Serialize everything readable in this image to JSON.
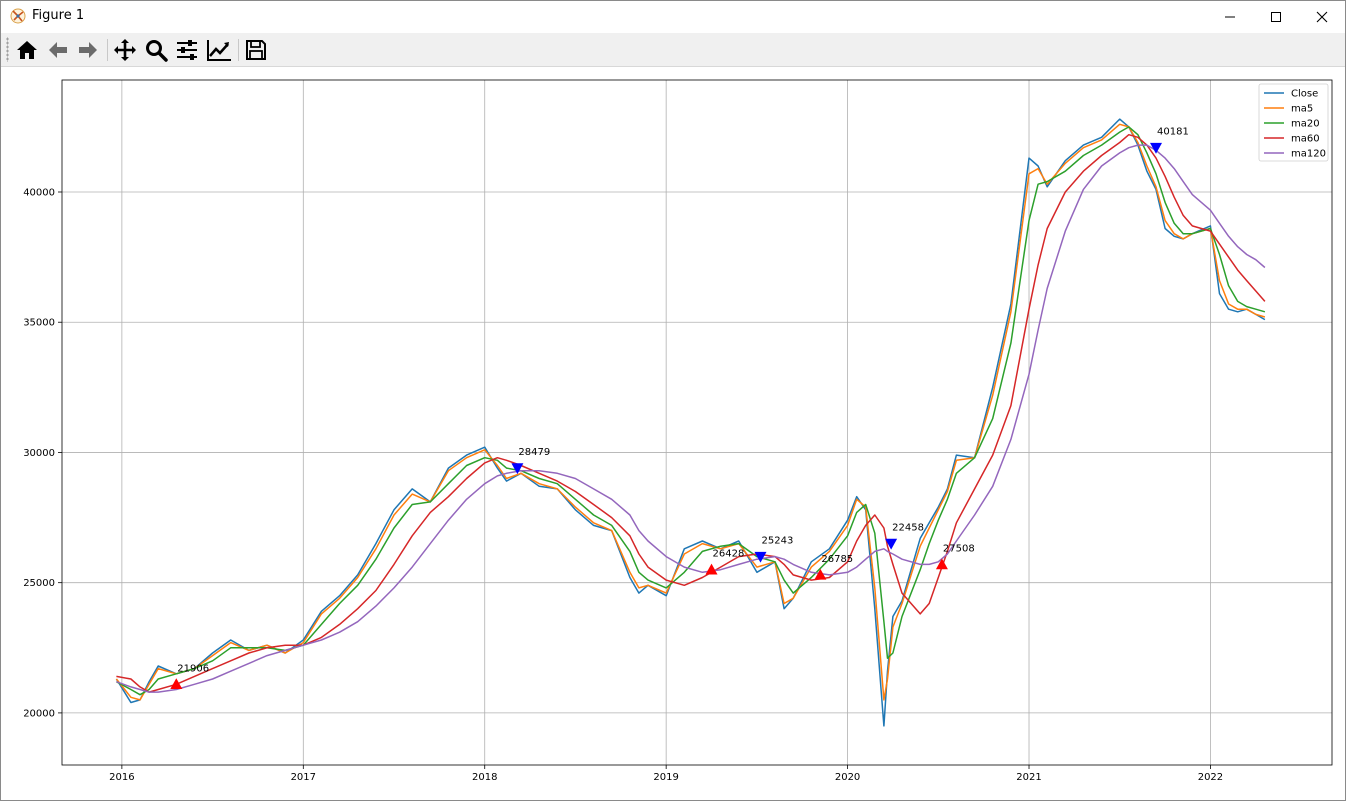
{
  "window": {
    "title": "Figure 1",
    "controls": {
      "minimize": "minimize",
      "maximize": "maximize",
      "close": "close"
    }
  },
  "toolbar": {
    "tools": [
      {
        "name": "home",
        "icon": "home-icon"
      },
      {
        "name": "back",
        "icon": "arrow-left-icon"
      },
      {
        "name": "forward",
        "icon": "arrow-right-icon"
      },
      {
        "name": "pan",
        "icon": "move-icon"
      },
      {
        "name": "zoom",
        "icon": "magnifier-icon"
      },
      {
        "name": "configure-subplots",
        "icon": "sliders-icon"
      },
      {
        "name": "edit-axis",
        "icon": "line-chart-icon"
      },
      {
        "name": "save",
        "icon": "floppy-disk-icon"
      }
    ]
  },
  "chart_data": {
    "type": "line",
    "title": "",
    "xlabel": "",
    "ylabel": "",
    "grid": true,
    "legend_position": "top-right",
    "x_range": [
      2015.67,
      2022.67
    ],
    "ylim": [
      18000,
      44300
    ],
    "x_ticks": [
      {
        "value": 2016,
        "label": "2016"
      },
      {
        "value": 2017,
        "label": "2017"
      },
      {
        "value": 2018,
        "label": "2018"
      },
      {
        "value": 2019,
        "label": "2019"
      },
      {
        "value": 2020,
        "label": "2020"
      },
      {
        "value": 2021,
        "label": "2021"
      },
      {
        "value": 2022,
        "label": "2022"
      }
    ],
    "y_ticks": [
      {
        "value": 20000,
        "label": "20000"
      },
      {
        "value": 25000,
        "label": "25000"
      },
      {
        "value": 30000,
        "label": "30000"
      },
      {
        "value": 35000,
        "label": "35000"
      },
      {
        "value": 40000,
        "label": "40000"
      }
    ],
    "x": [
      2015.97,
      2016.05,
      2016.1,
      2016.15,
      2016.2,
      2016.3,
      2016.4,
      2016.5,
      2016.6,
      2016.7,
      2016.8,
      2016.9,
      2017.0,
      2017.1,
      2017.2,
      2017.3,
      2017.4,
      2017.5,
      2017.6,
      2017.7,
      2017.8,
      2017.9,
      2018.0,
      2018.07,
      2018.12,
      2018.2,
      2018.3,
      2018.4,
      2018.5,
      2018.6,
      2018.7,
      2018.8,
      2018.85,
      2018.9,
      2019.0,
      2019.1,
      2019.2,
      2019.3,
      2019.4,
      2019.5,
      2019.6,
      2019.65,
      2019.7,
      2019.8,
      2019.9,
      2020.0,
      2020.05,
      2020.1,
      2020.15,
      2020.2,
      2020.22,
      2020.25,
      2020.3,
      2020.4,
      2020.45,
      2020.5,
      2020.55,
      2020.6,
      2020.7,
      2020.8,
      2020.9,
      2021.0,
      2021.05,
      2021.1,
      2021.2,
      2021.3,
      2021.4,
      2021.5,
      2021.55,
      2021.6,
      2021.65,
      2021.7,
      2021.75,
      2021.8,
      2021.85,
      2021.9,
      2022.0,
      2022.05,
      2022.1,
      2022.15,
      2022.2,
      2022.25,
      2022.3
    ],
    "series": [
      {
        "name": "Close",
        "color": "#1f77b4",
        "values": [
          21300,
          20400,
          20500,
          21200,
          21800,
          21500,
          21700,
          22300,
          22800,
          22400,
          22600,
          22300,
          22800,
          23900,
          24500,
          25300,
          26500,
          27800,
          28600,
          28100,
          29400,
          29900,
          30200,
          29400,
          28900,
          29200,
          28700,
          28600,
          27800,
          27200,
          27000,
          25200,
          24600,
          24900,
          24500,
          26300,
          26600,
          26300,
          26600,
          25400,
          25800,
          24000,
          24400,
          25800,
          26300,
          27400,
          28300,
          27800,
          24000,
          19500,
          21600,
          23700,
          24300,
          26700,
          27300,
          27900,
          28600,
          29900,
          29800,
          32500,
          35700,
          41300,
          41000,
          40200,
          41200,
          41800,
          42100,
          42800,
          42500,
          41800,
          40800,
          40100,
          38600,
          38300,
          38200,
          38400,
          38700,
          36100,
          35500,
          35400,
          35500,
          35300,
          35100
        ]
      },
      {
        "name": "ma5",
        "color": "#ff7f0e",
        "values": [
          21300,
          20600,
          20500,
          21100,
          21700,
          21500,
          21700,
          22200,
          22700,
          22400,
          22600,
          22300,
          22700,
          23800,
          24400,
          25200,
          26300,
          27600,
          28400,
          28100,
          29300,
          29800,
          30100,
          29500,
          29000,
          29200,
          28800,
          28600,
          27900,
          27300,
          27000,
          25400,
          24800,
          24900,
          24600,
          26100,
          26500,
          26300,
          26500,
          25600,
          25800,
          24200,
          24400,
          25600,
          26200,
          27200,
          28200,
          27900,
          24800,
          20500,
          21300,
          23300,
          24200,
          26400,
          27100,
          27800,
          28500,
          29700,
          29800,
          32200,
          35400,
          40700,
          40900,
          40300,
          41100,
          41700,
          42000,
          42600,
          42500,
          41900,
          41000,
          40200,
          38900,
          38400,
          38200,
          38400,
          38600,
          36600,
          35700,
          35500,
          35500,
          35300,
          35200
        ]
      },
      {
        "name": "ma20",
        "color": "#2ca02c",
        "values": [
          21200,
          20900,
          20700,
          20900,
          21300,
          21500,
          21700,
          22000,
          22500,
          22500,
          22500,
          22400,
          22600,
          23400,
          24200,
          24900,
          25900,
          27100,
          28000,
          28100,
          28800,
          29500,
          29800,
          29700,
          29400,
          29300,
          29000,
          28800,
          28200,
          27600,
          27200,
          26200,
          25400,
          25100,
          24800,
          25400,
          26200,
          26400,
          26500,
          26000,
          25800,
          25100,
          24600,
          25200,
          25900,
          26800,
          27700,
          28000,
          26900,
          23500,
          22100,
          22300,
          23700,
          25500,
          26500,
          27400,
          28200,
          29200,
          29800,
          31300,
          34200,
          38900,
          40300,
          40400,
          40800,
          41400,
          41800,
          42300,
          42500,
          42200,
          41500,
          40700,
          39600,
          38800,
          38400,
          38400,
          38600,
          37600,
          36400,
          35800,
          35600,
          35500,
          35400
        ]
      },
      {
        "name": "ma60",
        "color": "#d62728",
        "values": [
          21400,
          21300,
          21000,
          20800,
          20900,
          21100,
          21400,
          21700,
          22000,
          22300,
          22500,
          22600,
          22600,
          22900,
          23400,
          24000,
          24700,
          25700,
          26800,
          27700,
          28300,
          29000,
          29600,
          29800,
          29700,
          29500,
          29200,
          28900,
          28500,
          28000,
          27500,
          26800,
          26100,
          25600,
          25100,
          24900,
          25200,
          25600,
          26000,
          26100,
          26000,
          25700,
          25300,
          25100,
          25200,
          25800,
          26600,
          27200,
          27600,
          27100,
          26400,
          25700,
          24600,
          23800,
          24200,
          25200,
          26200,
          27300,
          28600,
          29900,
          31800,
          35500,
          37200,
          38600,
          40000,
          40800,
          41400,
          41900,
          42200,
          42100,
          41800,
          41300,
          40600,
          39800,
          39100,
          38700,
          38500,
          38000,
          37500,
          37000,
          36600,
          36200,
          35800
        ]
      },
      {
        "name": "ma120",
        "color": "#9467bd",
        "values": [
          21200,
          21000,
          20900,
          20800,
          20800,
          20900,
          21100,
          21300,
          21600,
          21900,
          22200,
          22400,
          22600,
          22800,
          23100,
          23500,
          24100,
          24800,
          25600,
          26500,
          27400,
          28200,
          28800,
          29100,
          29200,
          29300,
          29300,
          29200,
          29000,
          28600,
          28200,
          27600,
          27000,
          26600,
          26000,
          25600,
          25400,
          25500,
          25700,
          25900,
          26000,
          25900,
          25700,
          25400,
          25300,
          25400,
          25600,
          25900,
          26200,
          26300,
          26200,
          26100,
          25900,
          25700,
          25700,
          25800,
          26100,
          26600,
          27600,
          28700,
          30500,
          33000,
          34700,
          36300,
          38500,
          40100,
          41000,
          41500,
          41700,
          41800,
          41800,
          41600,
          41300,
          40900,
          40400,
          39900,
          39300,
          38800,
          38300,
          37900,
          37600,
          37400,
          37100
        ]
      }
    ],
    "annotations": [
      {
        "label": "21906",
        "x": 2016.3,
        "y": 21100,
        "marker": "triangle-up",
        "color": "#ff0000"
      },
      {
        "label": "28479",
        "x": 2018.18,
        "y": 29400,
        "marker": "triangle-down",
        "color": "#0000ff"
      },
      {
        "label": "26428",
        "x": 2019.25,
        "y": 25500,
        "marker": "triangle-up",
        "color": "#ff0000"
      },
      {
        "label": "25243",
        "x": 2019.52,
        "y": 26000,
        "marker": "triangle-down",
        "color": "#0000ff"
      },
      {
        "label": "26785",
        "x": 2019.85,
        "y": 25300,
        "marker": "triangle-up",
        "color": "#ff0000"
      },
      {
        "label": "22458",
        "x": 2020.24,
        "y": 26500,
        "marker": "triangle-down",
        "color": "#0000ff"
      },
      {
        "label": "27508",
        "x": 2020.52,
        "y": 25700,
        "marker": "triangle-up",
        "color": "#ff0000"
      },
      {
        "label": "40181",
        "x": 2021.7,
        "y": 41700,
        "marker": "triangle-down",
        "color": "#0000ff"
      }
    ]
  }
}
